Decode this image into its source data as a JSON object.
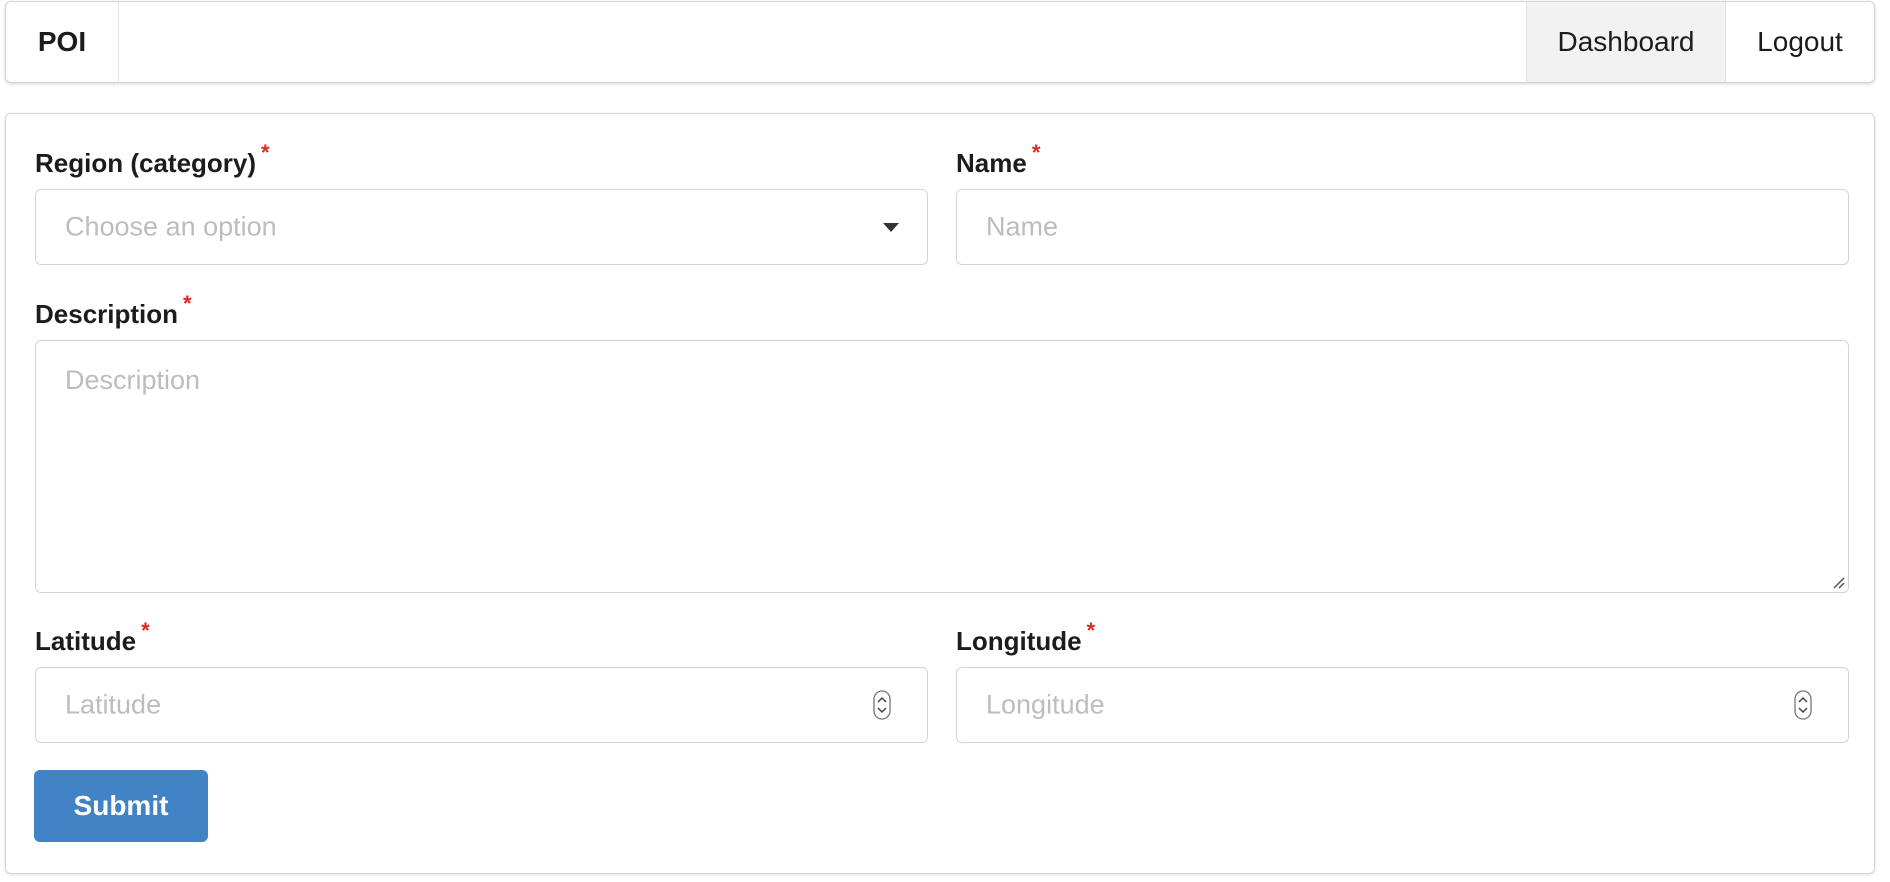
{
  "menu": {
    "brand": "POI",
    "dashboard": "Dashboard",
    "logout": "Logout"
  },
  "form": {
    "region": {
      "label": "Region (category)",
      "required": "*",
      "placeholder": "Choose an option"
    },
    "name": {
      "label": "Name",
      "required": "*",
      "placeholder": "Name"
    },
    "description": {
      "label": "Description",
      "required": "*",
      "placeholder": "Description"
    },
    "latitude": {
      "label": "Latitude",
      "required": "*",
      "placeholder": "Latitude"
    },
    "longitude": {
      "label": "Longitude",
      "required": "*",
      "placeholder": "Longitude"
    },
    "submit": "Submit"
  },
  "colors": {
    "accent": "#4183c4",
    "required": "#db2828",
    "active_menu_bg": "#f2f2f2"
  }
}
